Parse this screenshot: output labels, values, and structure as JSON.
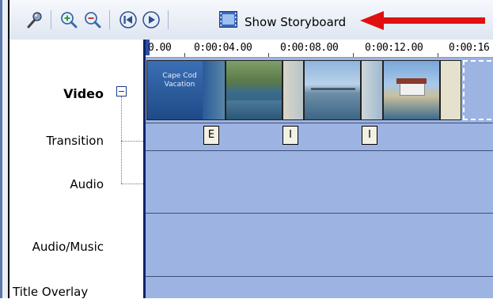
{
  "toolbar": {
    "storyboard_label": "Show Storyboard"
  },
  "ruler": {
    "ticks": [
      "0.00",
      "0:00:04.00",
      "0:00:08.00",
      "0:00:12.00",
      "0:00:16"
    ]
  },
  "tracks": {
    "video": "Video",
    "transition": "Transition",
    "audio": "Audio",
    "audio_music": "Audio/Music",
    "title_overlay": "Title Overlay"
  },
  "clips": {
    "first_clip_title": "Cape Cod Vacation"
  },
  "transitions": [
    "E",
    "I",
    "I"
  ],
  "colors": {
    "timeline_bg": "#9db4e3",
    "arrow": "#e01010",
    "row_line": "#3b4d7a"
  }
}
